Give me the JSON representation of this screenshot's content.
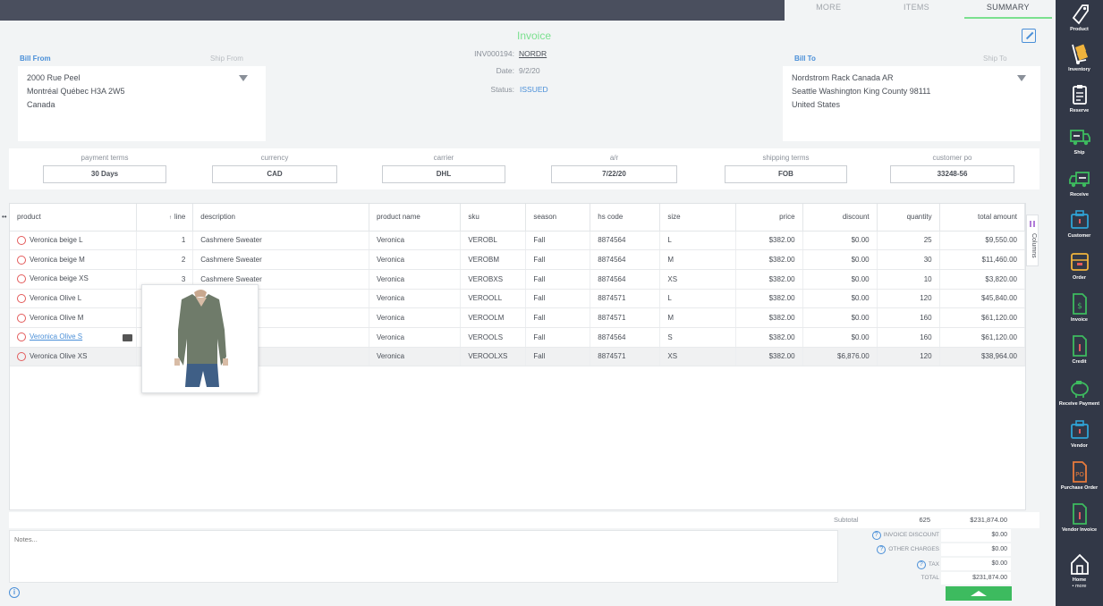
{
  "tabs": [
    {
      "label": "MORE"
    },
    {
      "label": "ITEMS"
    },
    {
      "label": "SUMMARY"
    }
  ],
  "bill_from": {
    "label": "Bill From",
    "alt_label": "Ship From",
    "line1": "2000 Rue Peel",
    "line2": "Montréal Québec H3A 2W5",
    "line3": "Canada"
  },
  "bill_to": {
    "label": "Bill To",
    "alt_label": "Ship To",
    "line1": "Nordstrom Rack Canada AR",
    "line2": "Seattle Washington King County 98111",
    "line3": "United States"
  },
  "invoice": {
    "title": "Invoice",
    "number_label": "INV000194:",
    "number_value": "NORDR",
    "date_label": "Date:",
    "date_value": "9/2/20",
    "status_label": "Status:",
    "status_value": "ISSUED"
  },
  "terms": [
    {
      "label": "payment terms",
      "value": "30 Days"
    },
    {
      "label": "currency",
      "value": "CAD"
    },
    {
      "label": "carrier",
      "value": "DHL"
    },
    {
      "label": "a/r",
      "value": "7/22/20"
    },
    {
      "label": "shipping terms",
      "value": "FOB"
    },
    {
      "label": "customer po",
      "value": "33248-56"
    }
  ],
  "grid": {
    "columns": [
      "product",
      "line",
      "description",
      "product name",
      "sku",
      "season",
      "hs code",
      "size",
      "price",
      "discount",
      "quantity",
      "total amount"
    ],
    "rows": [
      [
        "Veronica beige L",
        "1",
        "Cashmere Sweater",
        "Veronica",
        "VEROBL",
        "Fall",
        "8874564",
        "L",
        "$382.00",
        "$0.00",
        "25",
        "$9,550.00"
      ],
      [
        "Veronica beige M",
        "2",
        "Cashmere Sweater",
        "Veronica",
        "VEROBM",
        "Fall",
        "8874564",
        "M",
        "$382.00",
        "$0.00",
        "30",
        "$11,460.00"
      ],
      [
        "Veronica beige XS",
        "3",
        "Cashmere Sweater",
        "Veronica",
        "VEROBXS",
        "Fall",
        "8874564",
        "XS",
        "$382.00",
        "$0.00",
        "10",
        "$3,820.00"
      ],
      [
        "Veronica Olive L",
        "",
        "r",
        "Veronica",
        "VEROOLL",
        "Fall",
        "8874571",
        "L",
        "$382.00",
        "$0.00",
        "120",
        "$45,840.00"
      ],
      [
        "Veronica Olive M",
        "",
        "r",
        "Veronica",
        "VEROOLM",
        "Fall",
        "8874571",
        "M",
        "$382.00",
        "$0.00",
        "160",
        "$61,120.00"
      ],
      [
        "Veronica Olive S",
        "",
        "r",
        "Veronica",
        "VEROOLS",
        "Fall",
        "8874564",
        "S",
        "$382.00",
        "$0.00",
        "160",
        "$61,120.00"
      ],
      [
        "Veronica Olive XS",
        "",
        "r",
        "Veronica",
        "VEROOLXS",
        "Fall",
        "8874571",
        "XS",
        "$382.00",
        "$6,876.00",
        "120",
        "$38,964.00"
      ]
    ],
    "columns_tab": "Columns",
    "left_marker": "••"
  },
  "subtotal": {
    "label": "Subtotal",
    "quantity": "625",
    "amount": "$231,874.00"
  },
  "notes_placeholder": "Notes...",
  "summary": [
    {
      "label": "INVOICE DISCOUNT",
      "value": "$0.00",
      "help": "?"
    },
    {
      "label": "OTHER CHARGES",
      "value": "$0.00",
      "help": "?"
    },
    {
      "label": "TAX",
      "value": "$0.00",
      "help": "?"
    },
    {
      "label": "TOTAL",
      "value": "$231,874.00",
      "help": ""
    }
  ],
  "info_glyph": "i",
  "sidebar": [
    {
      "label": "Product",
      "icon": "tag-icon"
    },
    {
      "label": "Inventory",
      "icon": "dolly-icon"
    },
    {
      "label": "Reserve",
      "icon": "clipboard-icon"
    },
    {
      "label": "Ship",
      "icon": "truck-icon"
    },
    {
      "label": "Receive",
      "icon": "truck-receive-icon"
    },
    {
      "label": "Customer",
      "icon": "briefcase-icon"
    },
    {
      "label": "Order",
      "icon": "box-icon"
    },
    {
      "label": "Invoice",
      "icon": "invoice-icon"
    },
    {
      "label": "Credit",
      "icon": "credit-icon"
    },
    {
      "label": "Receive Payment",
      "icon": "piggy-bank-icon"
    },
    {
      "label": "Vendor",
      "icon": "vendor-icon"
    },
    {
      "label": "Purchase Order",
      "icon": "purchase-order-icon"
    },
    {
      "label": "Vendor Invoice",
      "icon": "vendor-invoice-icon"
    },
    {
      "label": "Home",
      "icon": "home-icon"
    },
    {
      "label": "• more",
      "icon": ""
    }
  ],
  "colors": {
    "accent_green": "#7be08f",
    "link_blue": "#4a8fd8",
    "sidebar_bg": "#323847",
    "topbar_bg": "#4a4f5e"
  }
}
